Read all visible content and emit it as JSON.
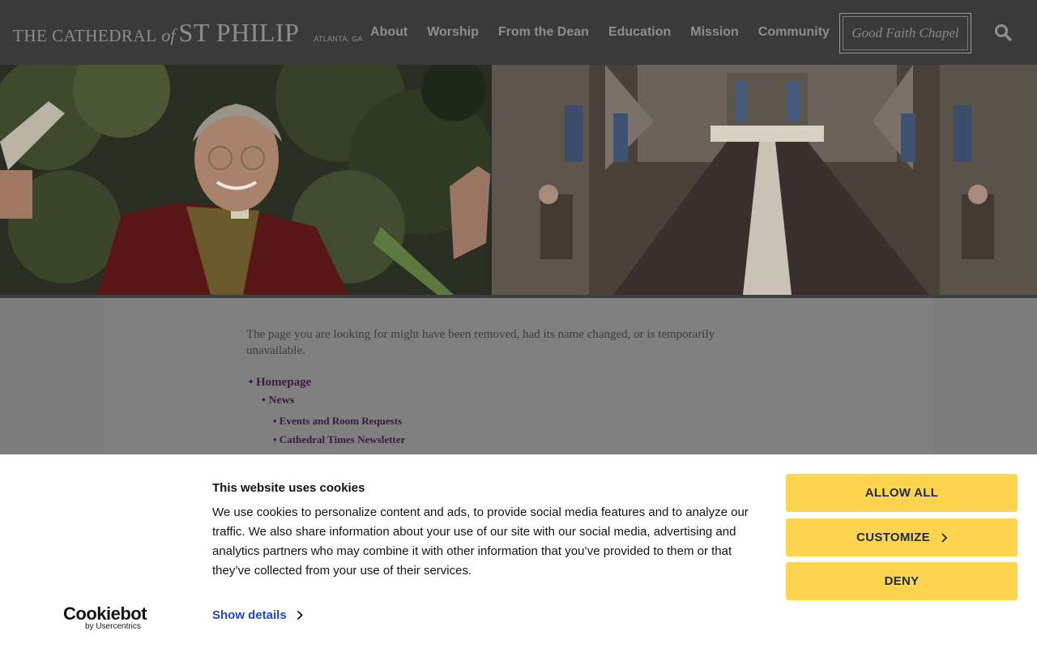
{
  "header": {
    "logo": {
      "main": "THE CATHEDRAL",
      "of": "of",
      "name": "ST PHILIP",
      "location": "ATLANTA, GA"
    },
    "nav": [
      "About",
      "Worship",
      "From the Dean",
      "Education",
      "Mission",
      "Community"
    ],
    "chapel_button": "Good Faith Chapel",
    "search_icon": "search-icon"
  },
  "hero": {
    "left_image": "priest-blessing-photo",
    "right_image": "cathedral-nave-congregation-photo"
  },
  "main": {
    "message": "The page you are looking for might have been removed, had its name changed, or is temporarily unavailable.",
    "links": [
      {
        "label": "• Homepage",
        "level": 0
      },
      {
        "label": "• News",
        "level": 1
      },
      {
        "label": "• Events and Room Requests",
        "level": 2
      },
      {
        "label": "• Cathedral Times Newsletter",
        "level": 2
      }
    ]
  },
  "cookie_banner": {
    "title": "This website uses cookies",
    "body": "We use cookies to personalize content and ads, to provide social media features and to analyze our traffic. We also share information about your use of our site with our social media, advertising and analytics partners who may combine it with other information that you’ve provided to them or that they’ve collected from your use of their services.",
    "show_details": "Show details",
    "logo_main": "Cookiebot",
    "logo_sub": "by Usercentrics",
    "buttons": {
      "allow_all": "ALLOW ALL",
      "customize": "CUSTOMIZE",
      "deny": "DENY"
    },
    "colors": {
      "button_bg": "#ffd44e",
      "link": "#1e47c3",
      "overlay": "#000000"
    }
  }
}
